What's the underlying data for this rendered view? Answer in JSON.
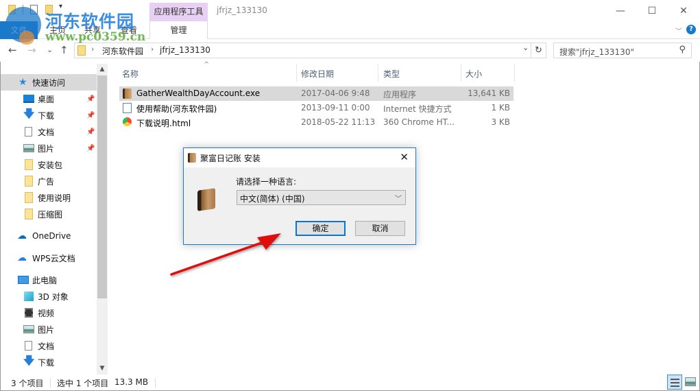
{
  "window": {
    "title": "jfrjz_133130",
    "context_tab_header": "应用程序工具",
    "controls": {
      "minimize": "—",
      "maximize": "☐",
      "close": "✕"
    }
  },
  "ribbon": {
    "file_tab": "文件",
    "tabs": [
      "主页",
      "共享",
      "查看"
    ],
    "context_tab": "管理",
    "expand_icon": "chevron-down-icon",
    "help_label": "?"
  },
  "navigation": {
    "back": "←",
    "forward": "→",
    "recent": "⌄",
    "up": "↑",
    "breadcrumbs": [
      "河东软件园",
      "jfrjz_133130"
    ],
    "breadcrumb_separator": "›",
    "refresh": "↻",
    "search_placeholder": "搜索\"jfrjz_133130\""
  },
  "sidebar": {
    "items": [
      {
        "label": "快速访问",
        "icon": "star-icon",
        "selected": true,
        "pinned": false
      },
      {
        "label": "桌面",
        "icon": "desktop-icon",
        "pinned": true
      },
      {
        "label": "下载",
        "icon": "download-icon",
        "pinned": true
      },
      {
        "label": "文档",
        "icon": "document-icon",
        "pinned": true
      },
      {
        "label": "图片",
        "icon": "picture-icon",
        "pinned": true
      },
      {
        "label": "安装包",
        "icon": "folder-icon",
        "pinned": false
      },
      {
        "label": "广告",
        "icon": "folder-icon",
        "pinned": false
      },
      {
        "label": "使用说明",
        "icon": "folder-icon",
        "pinned": false
      },
      {
        "label": "压缩图",
        "icon": "folder-icon",
        "pinned": false
      },
      {
        "label": "OneDrive",
        "icon": "onedrive-icon",
        "pinned": false
      },
      {
        "label": "WPS云文档",
        "icon": "wps-cloud-icon",
        "pinned": false
      },
      {
        "label": "此电脑",
        "icon": "computer-icon",
        "pinned": false
      },
      {
        "label": "3D 对象",
        "icon": "3d-objects-icon",
        "pinned": false
      },
      {
        "label": "视频",
        "icon": "video-icon",
        "pinned": false
      },
      {
        "label": "图片",
        "icon": "picture-icon",
        "pinned": false
      },
      {
        "label": "文档",
        "icon": "document-icon",
        "pinned": false
      },
      {
        "label": "下载",
        "icon": "download-icon",
        "pinned": false
      }
    ]
  },
  "filelist": {
    "columns": [
      "名称",
      "修改日期",
      "类型",
      "大小"
    ],
    "rows": [
      {
        "name": "GatherWealthDayAccount.exe",
        "date": "2017-04-06 9:48",
        "type": "应用程序",
        "size": "13,641 KB",
        "icon": "app-book-icon",
        "selected": true
      },
      {
        "name": "使用帮助(河东软件园)",
        "date": "2013-09-11 0:00",
        "type": "Internet 快捷方式",
        "size": "1 KB",
        "icon": "internet-shortcut-icon",
        "selected": false
      },
      {
        "name": "下载说明.html",
        "date": "2018-05-22 11:13",
        "type": "360 Chrome HT...",
        "size": "3 KB",
        "icon": "chrome-html-icon",
        "selected": false
      }
    ]
  },
  "statusbar": {
    "item_count": "3 个项目",
    "selected_count": "选中 1 个项目",
    "selected_size": "13.3 MB"
  },
  "dialog": {
    "title": "聚富日记账 安装",
    "close": "✕",
    "prompt": "请选择一种语言:",
    "language_selected": "中文(简体) (中国)",
    "ok_label": "确定",
    "cancel_label": "取消"
  },
  "watermark": {
    "site_name": "河东软件园",
    "url": "www.pc0359.cn"
  },
  "colors": {
    "accent": "#1979ca",
    "context_tab": "#e8d0f4",
    "selection": "#d9d9d9",
    "arrow": "#e01010"
  }
}
